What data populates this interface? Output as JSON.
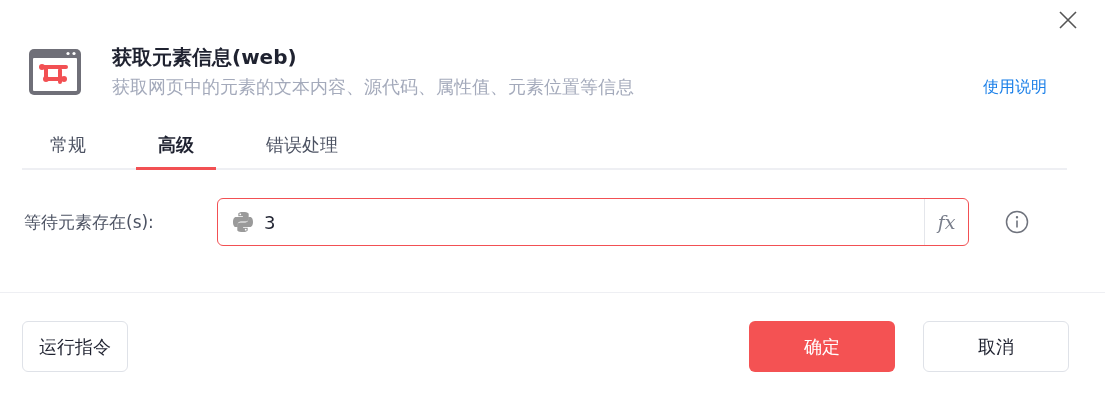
{
  "header": {
    "title": "获取元素信息(web)",
    "subtitle": "获取网页中的元素的文本内容、源代码、属性值、元素位置等信息",
    "help_link": "使用说明"
  },
  "tabs": [
    {
      "label": "常规",
      "selected": false
    },
    {
      "label": "高级",
      "selected": true
    },
    {
      "label": "错误处理",
      "selected": false
    }
  ],
  "fields": [
    {
      "label": "等待元素存在(s):",
      "value": "3",
      "invalid": true,
      "formula_button": "fx"
    }
  ],
  "buttons": [
    {
      "label": "运行指令",
      "kind": "default"
    },
    {
      "label": "确定",
      "kind": "primary"
    },
    {
      "label": "取消",
      "kind": "default"
    }
  ]
}
